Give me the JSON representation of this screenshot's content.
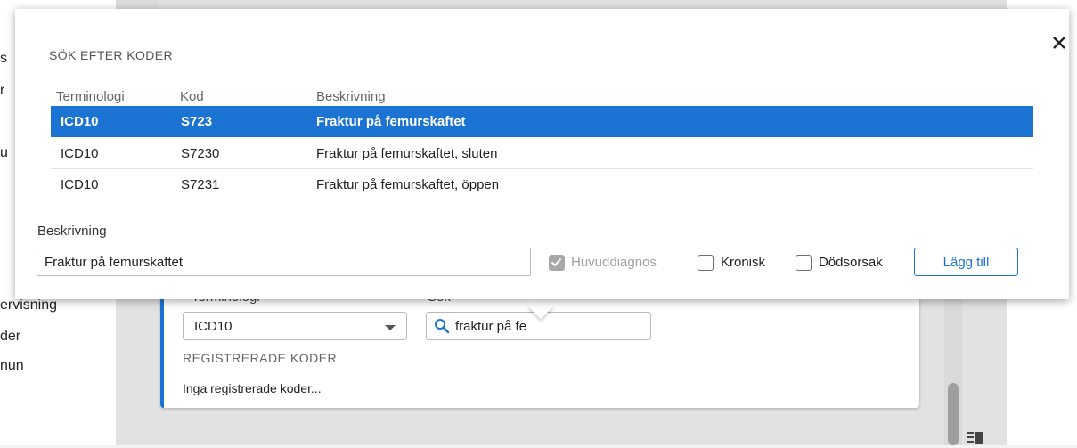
{
  "background": {
    "nav": [
      {
        "label": "s"
      },
      {
        "label": "r"
      },
      {
        "label": "u"
      },
      {
        "label": "ervisning"
      },
      {
        "label": "der"
      },
      {
        "label": "nun"
      }
    ],
    "terminology_label_cut": "Terminologi",
    "search_label_cut": "Sök",
    "terminology_select_value": "ICD10",
    "search_input_value": "fraktur på fe",
    "registered_title": "REGISTRERADE KODER",
    "registered_empty": "Inga registrerade koder..."
  },
  "popup": {
    "title": "SÖK EFTER KODER",
    "columns": [
      "Terminologi",
      "Kod",
      "Beskrivning"
    ],
    "rows": [
      {
        "terminology": "ICD10",
        "code": "S723",
        "description": "Fraktur på femurskaftet",
        "selected": true
      },
      {
        "terminology": "ICD10",
        "code": "S7230",
        "description": "Fraktur på femurskaftet, sluten",
        "selected": false
      },
      {
        "terminology": "ICD10",
        "code": "S7231",
        "description": "Fraktur på femurskaftet, öppen",
        "selected": false
      }
    ],
    "description_label": "Beskrivning",
    "description_value": "Fraktur på femurskaftet",
    "checkboxes": {
      "main_diagnosis": {
        "label": "Huvuddiagnos",
        "checked": true,
        "disabled": true
      },
      "chronic": {
        "label": "Kronisk",
        "checked": false
      },
      "cause_of_death": {
        "label": "Dödsorsak",
        "checked": false
      }
    },
    "add_button": "Lägg till"
  },
  "colors": {
    "accent": "#1b73d3",
    "selected_row_text": "#ffffff",
    "disabled": "#a8a8a8"
  },
  "icons": [
    "close-icon",
    "search-icon",
    "checkmark-icon",
    "caret-down-icon",
    "list-icon"
  ]
}
